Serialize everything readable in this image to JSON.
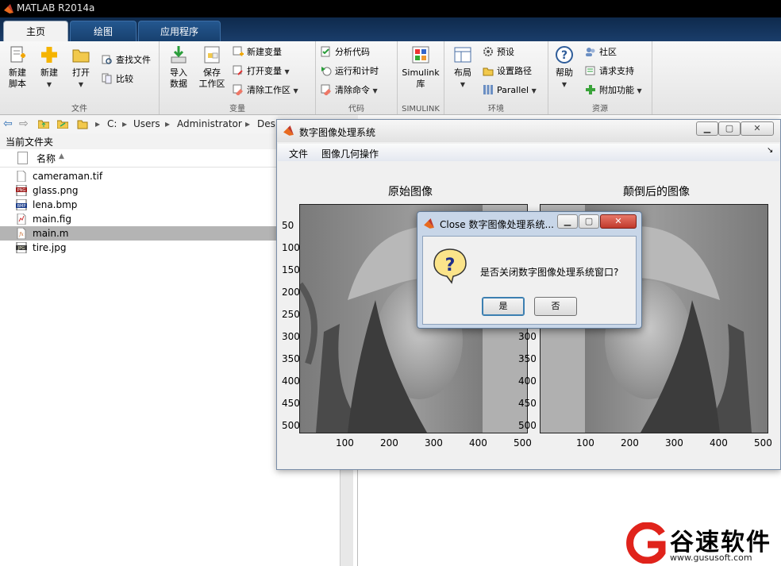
{
  "app": {
    "title": "MATLAB R2014a"
  },
  "tabs": [
    {
      "label": "主页",
      "active": true
    },
    {
      "label": "绘图",
      "active": false
    },
    {
      "label": "应用程序",
      "active": false
    }
  ],
  "ribbon": {
    "file_group": {
      "label": "文件",
      "new_script": "新建\n脚本",
      "new": "新建",
      "open": "打开",
      "find_files": "查找文件",
      "compare": "比较"
    },
    "variable_group": {
      "label": "变量",
      "import": "导入\n数据",
      "save_ws": "保存\n工作区",
      "new_var": "新建变量",
      "open_var": "打开变量",
      "clear_ws": "清除工作区"
    },
    "code_group": {
      "label": "代码",
      "analyze": "分析代码",
      "run_time": "运行和计时",
      "clear_cmd": "清除命令"
    },
    "simulink_group": {
      "label": "SIMULINK",
      "simulink": "Simulink\n库"
    },
    "env_group": {
      "label": "环境",
      "layout": "布局",
      "prefs": "预设",
      "set_path": "设置路径",
      "parallel": "Parallel"
    },
    "res_group": {
      "label": "资源",
      "help": "帮助",
      "community": "社区",
      "support": "请求支持",
      "addons": "附加功能"
    }
  },
  "address": {
    "segments": [
      "C:",
      "Users",
      "Administrator",
      "Des"
    ]
  },
  "file_panel": {
    "title": "当前文件夹",
    "column": "名称",
    "files": [
      {
        "name": "cameraman.tif",
        "icon": "tif-file-icon",
        "selected": false
      },
      {
        "name": "glass.png",
        "icon": "png-file-icon",
        "selected": false
      },
      {
        "name": "lena.bmp",
        "icon": "bmp-file-icon",
        "selected": false
      },
      {
        "name": "main.fig",
        "icon": "fig-file-icon",
        "selected": false
      },
      {
        "name": "main.m",
        "icon": "m-file-icon",
        "selected": true
      },
      {
        "name": "tire.jpg",
        "icon": "jpg-file-icon",
        "selected": false
      }
    ]
  },
  "figure": {
    "title": "数字图像处理系统",
    "menu": [
      "文件",
      "图像几何操作"
    ],
    "left_axes": {
      "title": "原始图像",
      "yticks": [
        "50",
        "100",
        "150",
        "200",
        "250",
        "300",
        "350",
        "400",
        "450",
        "500"
      ],
      "xticks": [
        "100",
        "200",
        "300",
        "400",
        "500"
      ]
    },
    "right_axes": {
      "title": "颠倒后的图像",
      "yticks": [
        "300",
        "350",
        "400",
        "450",
        "500"
      ],
      "xticks": [
        "100",
        "200",
        "300",
        "400",
        "500"
      ]
    }
  },
  "dialog": {
    "title": "Close 数字图像处理系统...",
    "message": "是否关闭数字图像处理系统窗口?",
    "yes": "是",
    "no": "否",
    "icon": "question-icon"
  },
  "watermark": {
    "brand": "谷速软件",
    "url": "www.gususoft.com",
    "color": "#e0231b"
  }
}
